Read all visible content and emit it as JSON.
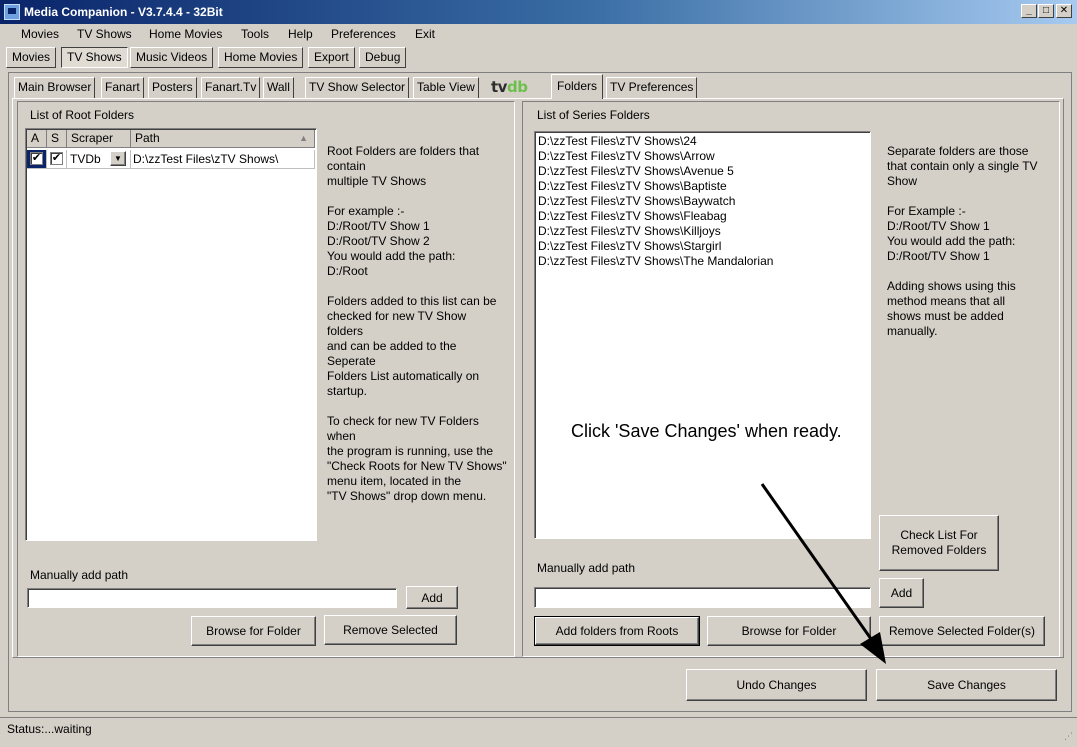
{
  "window": {
    "title": "Media Companion - V3.7.4.4 - 32Bit",
    "minimize": "_",
    "maximize": "□",
    "close": "✕"
  },
  "menu": [
    "Movies",
    "TV Shows",
    "Home Movies",
    "Tools",
    "Help",
    "Preferences",
    "Exit"
  ],
  "top_tabs": [
    "Movies",
    "TV Shows",
    "Music Videos",
    "Home Movies",
    "Export",
    "Debug"
  ],
  "active_top_tab": "TV Shows",
  "sub_tabs": [
    "Main Browser",
    "Fanart",
    "Posters",
    "Fanart.Tv",
    "Wall",
    "TV Show Selector",
    "Table View",
    "Folders",
    "TV Preferences"
  ],
  "tvdb_logo": {
    "part1": "tv",
    "part2": "db"
  },
  "active_sub_tab": "Folders",
  "root_folders": {
    "title": "List of Root Folders",
    "columns": [
      "A",
      "S",
      "Scraper",
      "Path"
    ],
    "rows": [
      {
        "a_checked": "✔",
        "s_checked": "✔",
        "scraper": "TVDb",
        "path": "D:\\zzTest Files\\zTV Shows\\"
      }
    ],
    "help": "Root Folders are folders that\ncontain\nmultiple TV Shows\n\nFor example :-\nD:/Root/TV Show 1\nD:/Root/TV Show 2\nYou would add the path:\nD:/Root\n\nFolders added to this list can be\nchecked for new TV Show\nfolders\nand can be added to the\nSeperate\nFolders List automatically on\nstartup.\n\nTo check for new TV Folders\nwhen\nthe program is running, use the\n\"Check Roots for New TV Shows\"\nmenu item, located in the\n\"TV Shows\" drop down menu.",
    "manual_label": "Manually add path",
    "manual_value": "",
    "add_label": "Add",
    "browse_label": "Browse for Folder",
    "remove_label": "Remove Selected"
  },
  "series_folders": {
    "title": "List of Series Folders",
    "items": [
      "D:\\zzTest Files\\zTV Shows\\24",
      "D:\\zzTest Files\\zTV Shows\\Arrow",
      "D:\\zzTest Files\\zTV Shows\\Avenue 5",
      "D:\\zzTest Files\\zTV Shows\\Baptiste",
      "D:\\zzTest Files\\zTV Shows\\Baywatch",
      "D:\\zzTest Files\\zTV Shows\\Fleabag",
      "D:\\zzTest Files\\zTV Shows\\Killjoys",
      "D:\\zzTest Files\\zTV Shows\\Stargirl",
      "D:\\zzTest Files\\zTV Shows\\The Mandalorian"
    ],
    "help": "Separate folders are those\nthat contain only a single TV\nShow\n\nFor Example :-\nD:/Root/TV Show 1\nYou would add the path:\nD:/Root/TV Show 1\n\nAdding shows using this\nmethod means that all\nshows must be added\nmanually.",
    "check_removed_label": "Check List For\nRemoved Folders",
    "manual_label": "Manually add path",
    "manual_value": "",
    "add_label": "Add",
    "add_from_roots_label": "Add folders from Roots",
    "browse_label": "Browse for Folder",
    "remove_label": "Remove Selected Folder(s)"
  },
  "annotation": "Click 'Save Changes' when ready.",
  "undo_label": "Undo Changes",
  "save_label": "Save Changes",
  "status": "Status:...waiting"
}
